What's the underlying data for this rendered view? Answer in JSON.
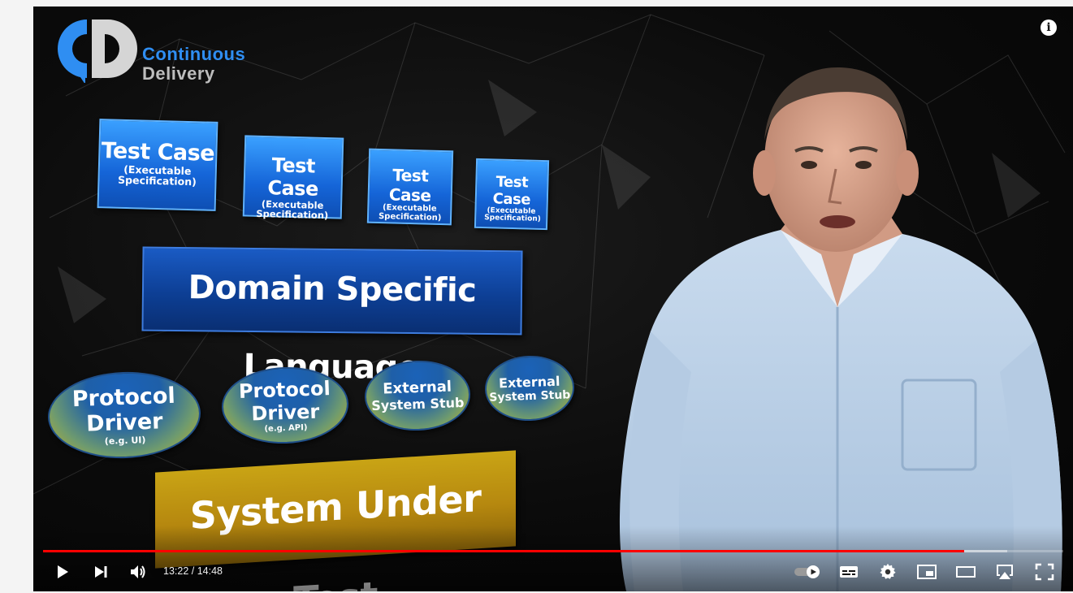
{
  "logo": {
    "line1": "Continuous",
    "line2": "Delivery"
  },
  "slide": {
    "test_cases": [
      {
        "title": "Test Case",
        "subtitle": "(Executable Specification)"
      },
      {
        "title": "Test Case",
        "subtitle": "(Executable Specification)"
      },
      {
        "title": "Test Case",
        "subtitle": "(Executable Specification)"
      },
      {
        "title": "Test Case",
        "subtitle": "(Executable Specification)"
      }
    ],
    "dsl": "Domain Specific Language",
    "drivers": [
      {
        "line1": "Protocol",
        "line2": "Driver",
        "note": "(e.g. UI)"
      },
      {
        "line1": "Protocol",
        "line2": "Driver",
        "note": "(e.g. API)"
      },
      {
        "line1": "External",
        "line2": "System Stub",
        "note": ""
      },
      {
        "line1": "External",
        "line2": "System Stub",
        "note": ""
      }
    ],
    "sut": "System Under Test"
  },
  "player": {
    "time_current": "13:22",
    "time_total": "14:48",
    "time_display": "13:22 / 14:48",
    "progress_played": 0.903,
    "progress_buffered": 0.945,
    "accent_color": "#ff0000",
    "icons": [
      "info-icon",
      "play-icon",
      "next-icon",
      "volume-icon",
      "autoplay-toggle-icon",
      "captions-icon",
      "settings-icon",
      "miniplayer-icon",
      "theater-icon",
      "airplay-icon",
      "fullscreen-icon"
    ]
  }
}
